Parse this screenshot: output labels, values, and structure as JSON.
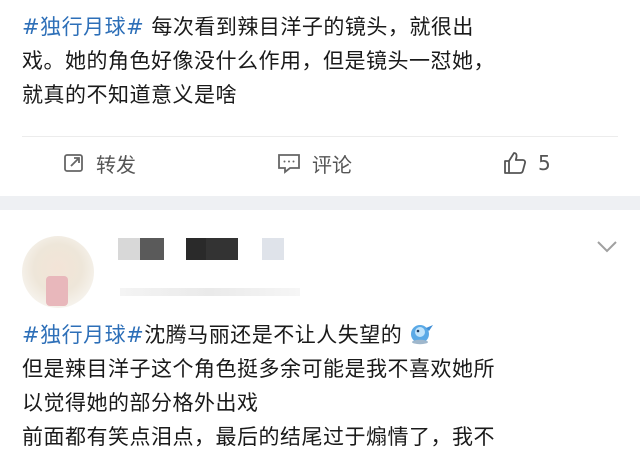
{
  "post1": {
    "tag": "#独行月球#",
    "body_line1": " 每次看到辣目洋子的镜头，就很出",
    "body_line2": "戏。她的角色好像没什么作用，但是镜头一怼她，",
    "body_line3": "就真的不知道意义是啥",
    "actions": {
      "repost_label": "转发",
      "comment_label": "评论",
      "like_count": "5"
    }
  },
  "post2": {
    "tag": "#独行月球#",
    "line1_text": "沈腾马丽还是不让人失望的",
    "line2": "但是辣目洋子这个角色挺多余可能是我不喜欢她所",
    "line3": "以觉得她的部分格外出戏",
    "line4": "前面都有笑点泪点，最后的结尾过于煽情了，我不"
  },
  "colors": {
    "tag": "#2d6fb8",
    "text": "#1a1a1a",
    "separator": "#eef0f3"
  }
}
